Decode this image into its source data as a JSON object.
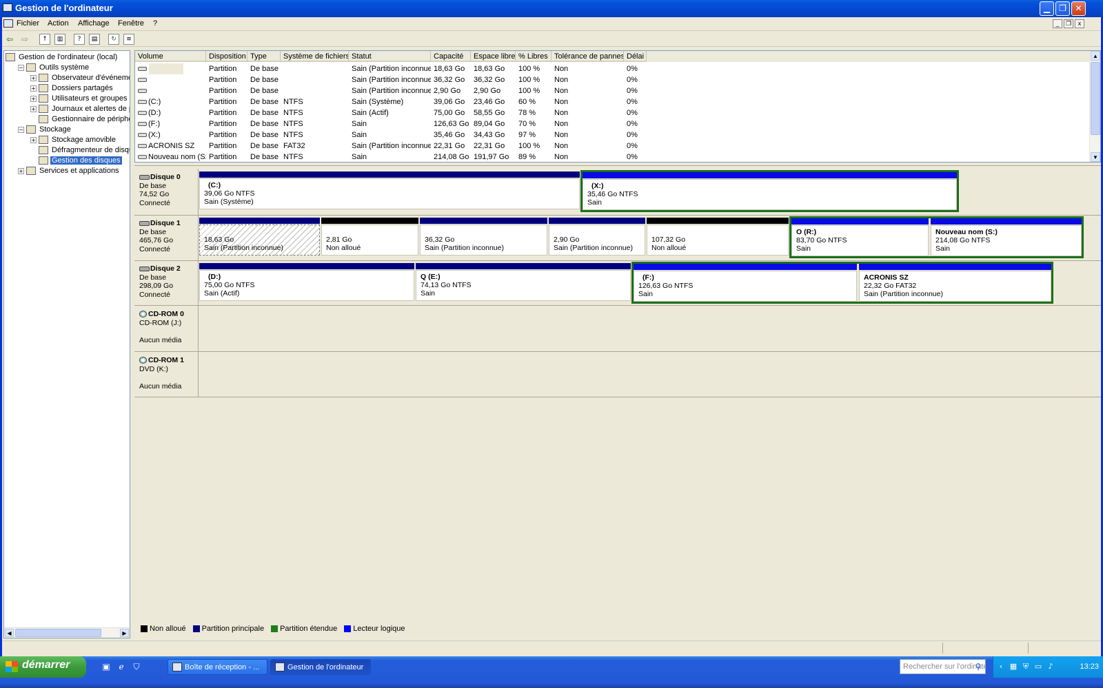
{
  "window": {
    "title": "Gestion de l'ordinateur"
  },
  "menu": [
    "Fichier",
    "Action",
    "Affichage",
    "Fenêtre",
    "?"
  ],
  "tree": [
    {
      "label": "Gestion de l'ordinateur (local)",
      "level": 0,
      "exp": "",
      "icon": "computer-icon"
    },
    {
      "label": "Outils système",
      "level": 1,
      "exp": "−",
      "icon": "tools-icon"
    },
    {
      "label": "Observateur d'événements",
      "level": 2,
      "exp": "+",
      "icon": "event-viewer-icon"
    },
    {
      "label": "Dossiers partagés",
      "level": 2,
      "exp": "+",
      "icon": "shared-folder-icon"
    },
    {
      "label": "Utilisateurs et groupes locaux",
      "level": 2,
      "exp": "+",
      "icon": "users-icon"
    },
    {
      "label": "Journaux et alertes de performance",
      "level": 2,
      "exp": "+",
      "icon": "performance-icon"
    },
    {
      "label": "Gestionnaire de périphériques",
      "level": 2,
      "exp": "",
      "icon": "device-manager-icon"
    },
    {
      "label": "Stockage",
      "level": 1,
      "exp": "−",
      "icon": "storage-icon"
    },
    {
      "label": "Stockage amovible",
      "level": 2,
      "exp": "+",
      "icon": "removable-storage-icon"
    },
    {
      "label": "Défragmenteur de disque",
      "level": 2,
      "exp": "",
      "icon": "defrag-icon"
    },
    {
      "label": "Gestion des disques",
      "level": 2,
      "exp": "",
      "icon": "disk-management-icon",
      "selected": true
    },
    {
      "label": "Services et applications",
      "level": 1,
      "exp": "+",
      "icon": "services-icon"
    }
  ],
  "columns": [
    "Volume",
    "Disposition",
    "Type",
    "Système de fichiers",
    "Statut",
    "Capacité",
    "Espace libre",
    "% Libres",
    "Tolérance de pannes",
    "Délai"
  ],
  "volumes": [
    [
      "",
      "Partition",
      "De base",
      "",
      "Sain (Partition inconnue)",
      "18,63 Go",
      "18,63 Go",
      "100 %",
      "Non",
      "0%"
    ],
    [
      "",
      "Partition",
      "De base",
      "",
      "Sain (Partition inconnue)",
      "36,32 Go",
      "36,32 Go",
      "100 %",
      "Non",
      "0%"
    ],
    [
      "",
      "Partition",
      "De base",
      "",
      "Sain (Partition inconnue)",
      "2,90 Go",
      "2,90 Go",
      "100 %",
      "Non",
      "0%"
    ],
    [
      "(C:)",
      "Partition",
      "De base",
      "NTFS",
      "Sain (Système)",
      "39,06 Go",
      "23,46 Go",
      "60 %",
      "Non",
      "0%"
    ],
    [
      "(D:)",
      "Partition",
      "De base",
      "NTFS",
      "Sain (Actif)",
      "75,00 Go",
      "58,55 Go",
      "78 %",
      "Non",
      "0%"
    ],
    [
      "(F:)",
      "Partition",
      "De base",
      "NTFS",
      "Sain",
      "126,63 Go",
      "89,04 Go",
      "70 %",
      "Non",
      "0%"
    ],
    [
      "(X:)",
      "Partition",
      "De base",
      "NTFS",
      "Sain",
      "35,46 Go",
      "34,43 Go",
      "97 %",
      "Non",
      "0%"
    ],
    [
      "ACRONIS SZ",
      "Partition",
      "De base",
      "FAT32",
      "Sain (Partition inconnue)",
      "22,31 Go",
      "22,31 Go",
      "100 %",
      "Non",
      "0%"
    ],
    [
      "Nouveau nom (S:)",
      "Partition",
      "De base",
      "NTFS",
      "Sain",
      "214,08 Go",
      "191,97 Go",
      "89 %",
      "Non",
      "0%"
    ]
  ],
  "disks": [
    {
      "name": "Disque 0",
      "type": "De base",
      "size": "74,52 Go",
      "state": "Connecté"
    },
    {
      "name": "Disque 1",
      "type": "De base",
      "size": "465,76 Go",
      "state": "Connecté"
    },
    {
      "name": "Disque 2",
      "type": "De base",
      "size": "298,09 Go",
      "state": "Connecté"
    },
    {
      "name": "CD-ROM 0",
      "type": "CD-ROM (J:)",
      "size": "",
      "state": "Aucun média"
    },
    {
      "name": "CD-ROM 1",
      "type": "DVD (K:)",
      "size": "",
      "state": "Aucun média"
    }
  ],
  "partitions": {
    "d0_c": {
      "name": "(C:)",
      "size": "39,06 Go NTFS",
      "status": "Sain (Système)"
    },
    "d0_x": {
      "name": "(X:)",
      "size": "35,46 Go NTFS",
      "status": "Sain"
    },
    "d1_p1": {
      "size": "18,63 Go",
      "status": "Sain (Partition inconnue)"
    },
    "d1_u1": {
      "size": "2,81 Go",
      "status": "Non alloué"
    },
    "d1_p2": {
      "size": "36,32 Go",
      "status": "Sain (Partition inconnue)"
    },
    "d1_p3": {
      "size": "2,90 Go",
      "status": "Sain (Partition inconnue)"
    },
    "d1_u2": {
      "size": "107,32 Go",
      "status": "Non alloué"
    },
    "d1_r": {
      "name": "O  (R:)",
      "size": "83,70 Go NTFS",
      "status": "Sain"
    },
    "d1_s": {
      "name": "Nouveau nom  (S:)",
      "size": "214,08 Go NTFS",
      "status": "Sain"
    },
    "d2_d": {
      "name": "(D:)",
      "size": "75,00 Go NTFS",
      "status": "Sain (Actif)"
    },
    "d2_e": {
      "name": "Q  (E:)",
      "size": "74,13 Go NTFS",
      "status": "Sain"
    },
    "d2_f": {
      "name": "(F:)",
      "size": "126,63 Go NTFS",
      "status": "Sain"
    },
    "d2_a": {
      "name": "ACRONIS SZ",
      "size": "22,32 Go FAT32",
      "status": "Sain (Partition inconnue)"
    }
  },
  "legend": [
    {
      "label": "Non alloué",
      "color": "#000000"
    },
    {
      "label": "Partition principale",
      "color": "#000080"
    },
    {
      "label": "Partition étendue",
      "color": "#1c7f1c"
    },
    {
      "label": "Lecteur logique",
      "color": "#0000ff"
    }
  ],
  "colors": {
    "primary": "#00007f",
    "unallocated": "#000000",
    "extended": "#1c6f1c",
    "logical": "#0a0ae6"
  },
  "taskbar": {
    "start": "démarrer",
    "tasks": [
      "Boîte de réception - ...",
      "Gestion de l'ordinateur"
    ],
    "search_placeholder": "Rechercher sur l'ordinateur",
    "clock": "13:23"
  }
}
